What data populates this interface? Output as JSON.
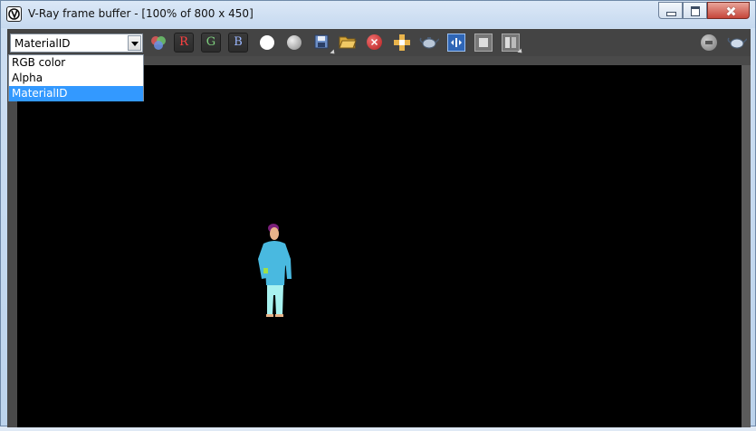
{
  "window": {
    "title": "V-Ray frame buffer - [100% of 800 x 450]"
  },
  "toolbar": {
    "channel_select": {
      "selected": "MaterialID",
      "options": [
        "RGB color",
        "Alpha",
        "MaterialID"
      ]
    },
    "buttons": {
      "red_label": "R",
      "green_label": "G",
      "blue_label": "B"
    },
    "colors": {
      "red": "#ff4040",
      "green": "#7fd27f",
      "blue": "#9bb7ff"
    }
  },
  "render": {
    "background": "#000000",
    "figure_colors": {
      "shirt": "#49b9e0",
      "pants": "#a8f2f0",
      "skin": "#e9b48a",
      "hair": "#7a1f7a"
    }
  }
}
